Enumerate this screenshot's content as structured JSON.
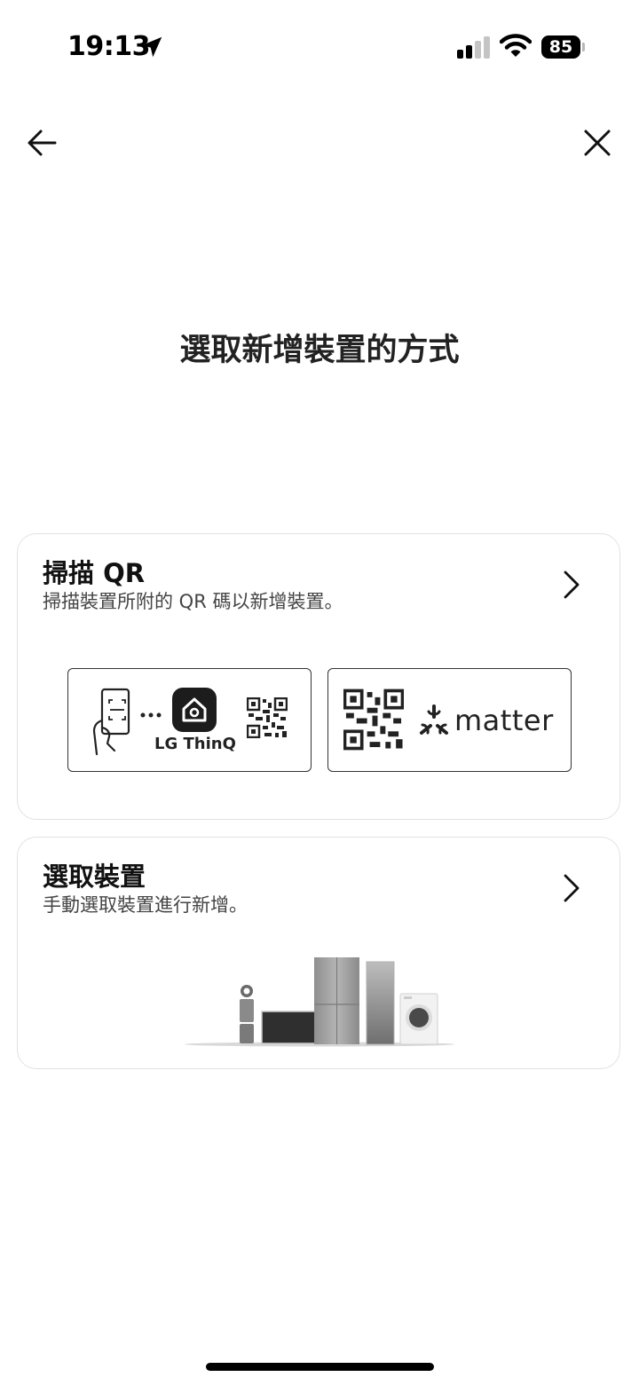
{
  "status_bar": {
    "time": "19:13",
    "battery_level": "85",
    "signal_bars_active": 2,
    "signal_bars_total": 4
  },
  "nav": {
    "back_icon": "arrow-left-icon",
    "close_icon": "close-icon"
  },
  "page": {
    "title": "選取新增裝置的方式"
  },
  "cards": {
    "scan_qr": {
      "title": "掃描 QR",
      "description": "掃描裝置所附的 QR 碼以新增裝置。",
      "options": {
        "thinq_label": "LG ThinQ",
        "matter_label": "matter"
      }
    },
    "select_device": {
      "title": "選取裝置",
      "description": "手動選取裝置進行新增。"
    }
  },
  "colors": {
    "text_primary": "#111111",
    "text_secondary": "#444444",
    "card_border": "#e2e2e2",
    "box_border": "#333333",
    "background": "#ffffff"
  }
}
